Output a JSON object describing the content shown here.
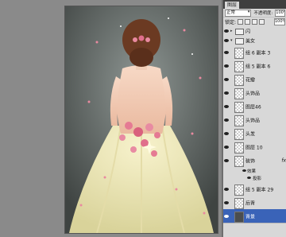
{
  "panel": {
    "tab_label": "图层",
    "blend_mode": "正常",
    "opacity_label": "不透明度:",
    "opacity_value": "100%",
    "lock_label": "锁定:",
    "fill_value": "100%"
  },
  "layers": [
    {
      "name": "闪",
      "kind": "folder"
    },
    {
      "name": "美女",
      "kind": "folder"
    },
    {
      "name": "组 6 副本 3",
      "kind": "layer"
    },
    {
      "name": "组 5 副本 6",
      "kind": "layer"
    },
    {
      "name": "花瓣",
      "kind": "layer"
    },
    {
      "name": "头饰品",
      "kind": "layer"
    },
    {
      "name": "图层46",
      "kind": "layer"
    },
    {
      "name": "头饰品",
      "kind": "layer"
    },
    {
      "name": "头发",
      "kind": "layer"
    },
    {
      "name": "图层 10",
      "kind": "layer"
    },
    {
      "name": "装饰",
      "kind": "layer",
      "fx": "fx"
    },
    {
      "name": "组 5 副本 29",
      "kind": "layer"
    },
    {
      "name": "后背",
      "kind": "layer"
    },
    {
      "name": "背景",
      "kind": "layer",
      "selected": true
    }
  ],
  "effects": {
    "label": "效果",
    "item": "投影"
  }
}
